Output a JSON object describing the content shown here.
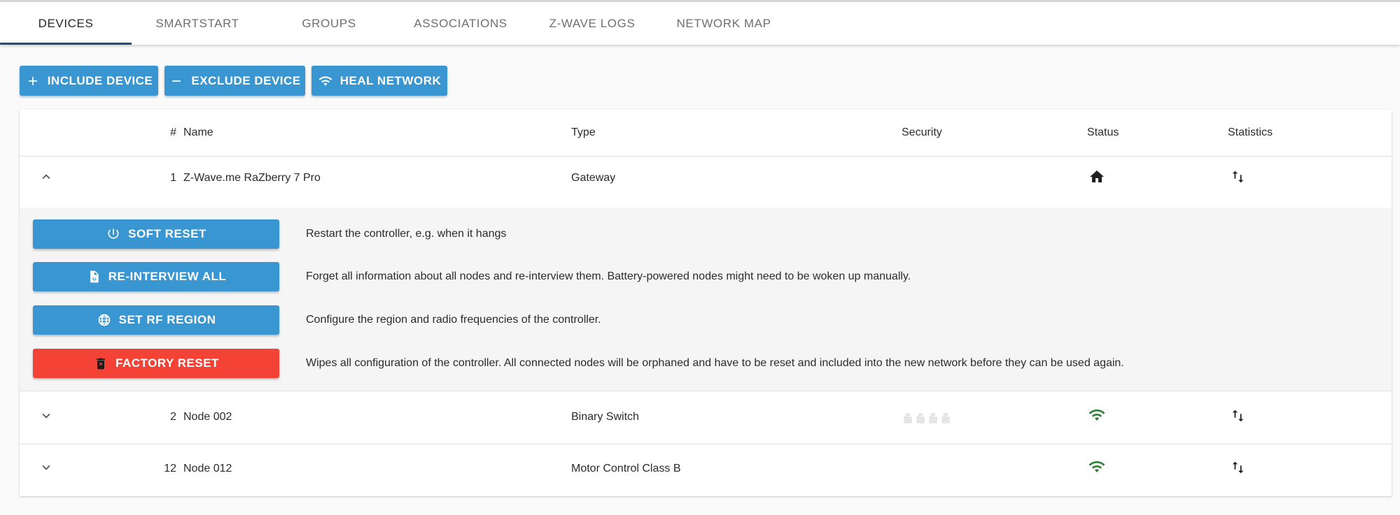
{
  "tabs": [
    {
      "label": "Devices"
    },
    {
      "label": "Smartstart"
    },
    {
      "label": "Groups"
    },
    {
      "label": "Associations"
    },
    {
      "label": "Z-Wave Logs"
    },
    {
      "label": "Network Map"
    }
  ],
  "toolbar": {
    "include_label": "Include Device",
    "exclude_label": "Exclude Device",
    "heal_label": "Heal Network"
  },
  "table": {
    "columns": {
      "id": "#",
      "name": "Name",
      "type": "Type",
      "security": "Security",
      "status": "Status",
      "statistics": "Statistics"
    },
    "rows": [
      {
        "id": "1",
        "name": "Z-Wave.me RaZberry 7 Pro",
        "type": "Gateway",
        "status_icon": "home-icon",
        "expanded": true
      },
      {
        "id": "2",
        "name": "Node 002",
        "type": "Binary Switch",
        "status_icon": "wifi-icon",
        "status_color": "#2e7d32",
        "security_icon": "lock-open-icon"
      },
      {
        "id": "12",
        "name": "Node 012",
        "type": "Motor Control Class B",
        "status_icon": "wifi-icon",
        "status_color": "#2e7d32"
      }
    ]
  },
  "controller_actions": [
    {
      "label": "Soft Reset",
      "description": "Restart the controller, e.g. when it hangs",
      "icon": "power-icon"
    },
    {
      "label": "Re-interview All",
      "description": "Forget all information about all nodes and re-interview them. Battery-powered nodes might need to be woken up manually.",
      "icon": "file-refresh-icon"
    },
    {
      "label": "Set RF Region",
      "description": "Configure the region and radio frequencies of the controller.",
      "icon": "globe-icon"
    },
    {
      "label": "Factory Reset",
      "description": "Wipes all configuration of the controller. All connected nodes will be orphaned and have to be reset and included into the new network before they can be used again.",
      "icon": "delete-icon"
    }
  ],
  "colors": {
    "primary_button": "#3a96d0",
    "danger_button": "#f44336",
    "tab_indicator": "#1e4e7e",
    "status_ok": "#2e7d32"
  }
}
